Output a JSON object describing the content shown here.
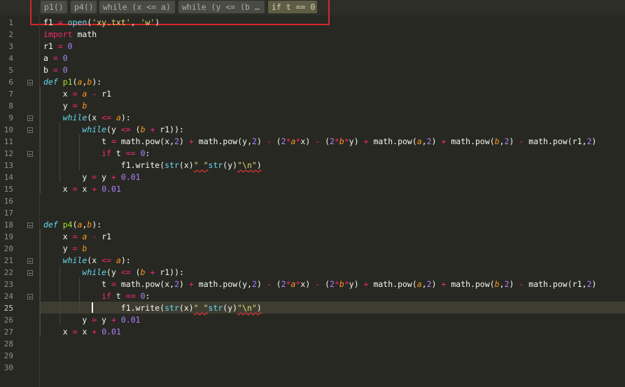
{
  "breadcrumbs": [
    {
      "label": "p1()",
      "active": false
    },
    {
      "label": "p4()",
      "active": false
    },
    {
      "label": "while (x <= a)",
      "active": false
    },
    {
      "label": "while (y <= (b …",
      "active": false
    },
    {
      "label": "if t == 0",
      "active": true
    }
  ],
  "line_numbers": [
    "1",
    "2",
    "3",
    "4",
    "5",
    "6",
    "7",
    "8",
    "9",
    "10",
    "11",
    "12",
    "13",
    "14",
    "15",
    "16",
    "17",
    "18",
    "19",
    "20",
    "21",
    "22",
    "23",
    "24",
    "25",
    "26",
    "27",
    "28",
    "29",
    "30"
  ],
  "current_line": "25",
  "colors": {
    "background": "#272822",
    "current_line": "#3e3d32",
    "keyword": "#f92672",
    "function": "#a6e22e",
    "parameter": "#fd971f",
    "number": "#ae81ff",
    "string": "#e6db74",
    "builtin": "#66d9ef",
    "highlight_box": "#d8262b"
  },
  "tokens": {
    "f1": "f1",
    "open": "open",
    "open_arg1": "'xy.txt'",
    "open_arg2": "'w'",
    "import": "import",
    "math": "math",
    "r1": "r1",
    "a": "a",
    "b": "b",
    "x": "x",
    "y": "y",
    "t": "t",
    "def": "def",
    "p1": "p1",
    "p4": "p4",
    "while": "while",
    "if": "if",
    "str": "str",
    "write": "write",
    "pow": "pow",
    "eq": "=",
    "eqeq": "==",
    "le": "<=",
    "plus": "+",
    "minus": "-",
    "star": "*",
    "comma": ",",
    "lp": "(",
    "rp": ")",
    "colon": ":",
    "dot": ".",
    "zero": "0",
    "two": "2",
    "step": "0.01",
    "space_str": "\" \"",
    "newline_str": "\"\\n\""
  }
}
